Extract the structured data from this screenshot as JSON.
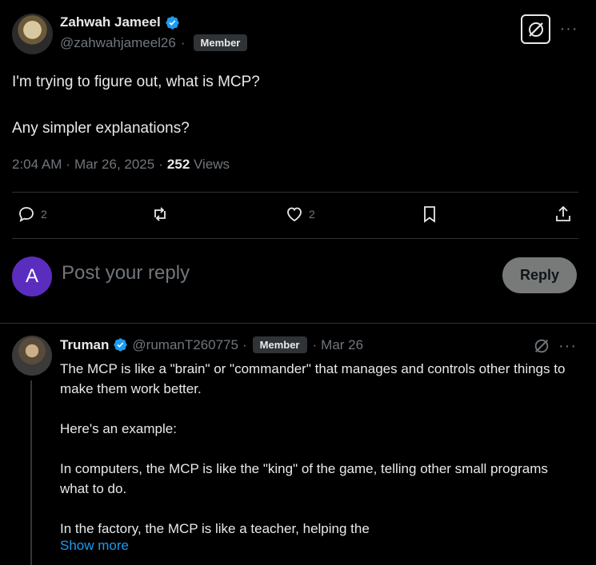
{
  "post": {
    "author_name": "Zahwah Jameel",
    "handle": "@zahwahjameel26",
    "separator": "·",
    "badge": "Member",
    "text_line1": "I'm trying to figure out, what is MCP?",
    "text_line2": "Any simpler explanations?",
    "time": "2:04 AM",
    "date": "Mar 26, 2025",
    "views_count": "252",
    "views_label": "Views",
    "dot": "·"
  },
  "actions": {
    "replies": "2",
    "likes": "2"
  },
  "composer": {
    "avatar_letter": "A",
    "placeholder": "Post your reply",
    "reply_button": "Reply"
  },
  "comment": {
    "author_name": "Truman",
    "handle": "@rumanT260775",
    "separator": "·",
    "badge": "Member",
    "date": "Mar 26",
    "line1": "The MCP is like a \"brain\" or \"commander\" that manages and controls other things to make them work better.",
    "line2": "Here's an example:",
    "line3": "In computers, the MCP is like the \"king\" of the game, telling other small programs what to do.",
    "line4": "In the factory, the MCP is like a teacher, helping the",
    "show_more": "Show more"
  },
  "colors": {
    "background": "#000000",
    "text": "#e7e9ea",
    "muted": "#71767b",
    "link": "#1d9bf0",
    "verified": "#1d9bf0",
    "divider": "#2f3336",
    "composer_avatar": "#5b2dbe"
  },
  "icons": [
    "verified-badge-icon",
    "grok-icon",
    "more-icon",
    "reply-icon",
    "repost-icon",
    "like-icon",
    "bookmark-icon",
    "share-icon"
  ]
}
